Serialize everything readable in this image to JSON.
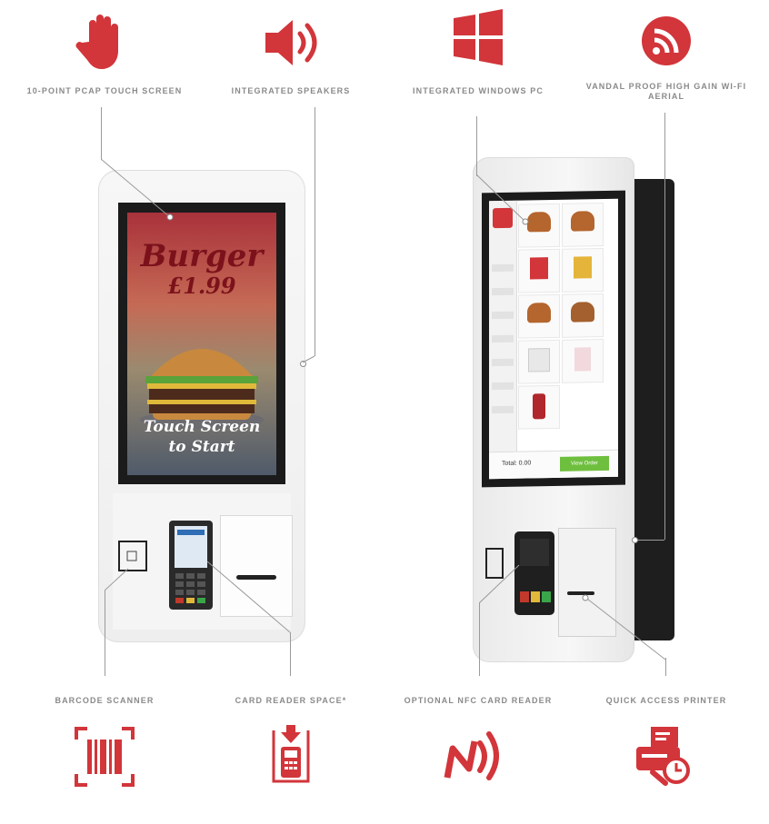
{
  "features_top": [
    {
      "id": "touch",
      "label": "10-POINT PCAP TOUCH SCREEN",
      "icon": "hand-icon"
    },
    {
      "id": "speakers",
      "label": "INTEGRATED SPEAKERS",
      "icon": "speaker-icon"
    },
    {
      "id": "windows",
      "label": "INTEGRATED WINDOWS PC",
      "icon": "windows-icon"
    },
    {
      "id": "wifi",
      "label": "VANDAL PROOF HIGH GAIN WI-FI AERIAL",
      "icon": "wifi-icon"
    }
  ],
  "features_bottom": [
    {
      "id": "barcode",
      "label": "BARCODE SCANNER",
      "icon": "barcode-icon"
    },
    {
      "id": "card",
      "label": "CARD READER SPACE*",
      "icon": "card-reader-icon"
    },
    {
      "id": "nfc",
      "label": "OPTIONAL NFC CARD READER",
      "icon": "nfc-icon"
    },
    {
      "id": "printer",
      "label": "QUICK ACCESS PRINTER",
      "icon": "printer-icon"
    }
  ],
  "kiosk1_screen": {
    "title": "Burger",
    "price": "£1.99",
    "cta_line1": "Touch Screen",
    "cta_line2": "to Start"
  },
  "kiosk2_screen": {
    "total": "Total: 0.00",
    "button": "View Order"
  },
  "colors": {
    "accent": "#d2353a",
    "label": "#8a8a8a"
  }
}
